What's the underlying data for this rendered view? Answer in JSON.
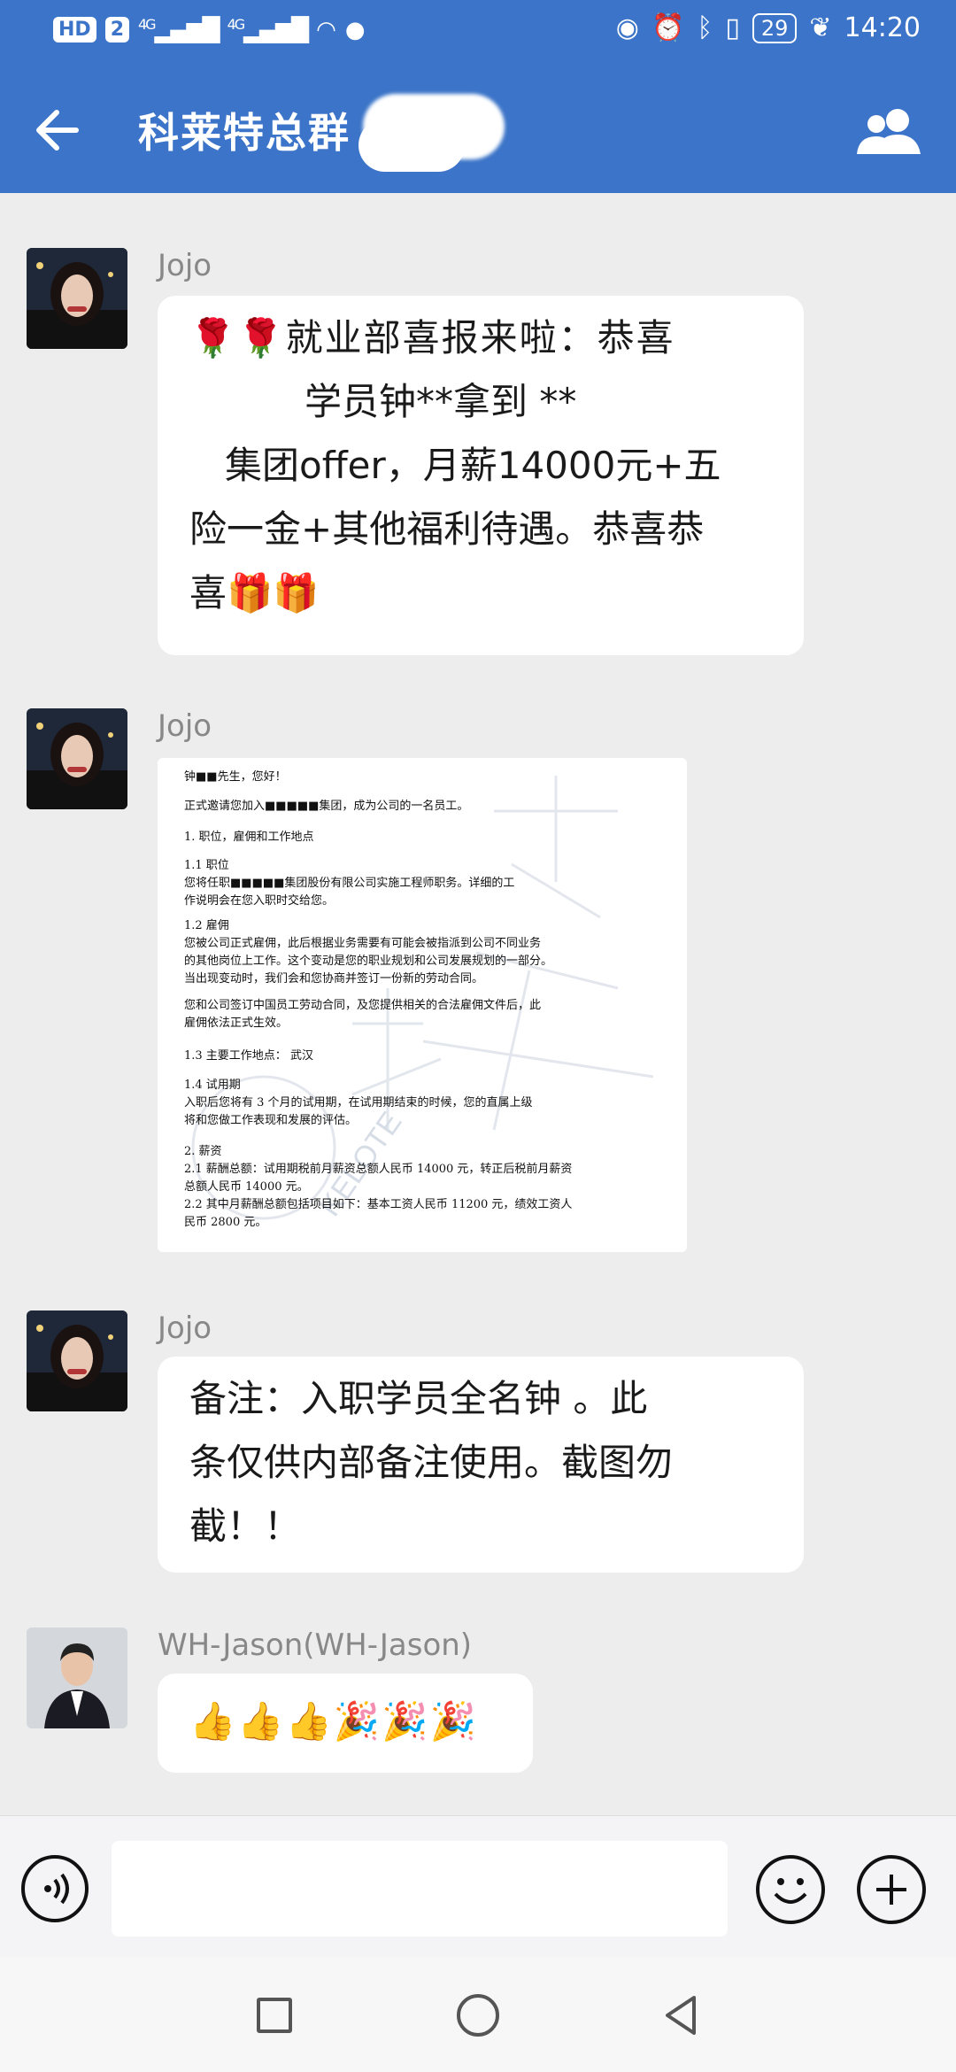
{
  "status_bar": {
    "left_badges": [
      "HD",
      "2",
      "4G",
      "4G"
    ],
    "battery": "29",
    "time": "14:20"
  },
  "header": {
    "title": "科莱特总群"
  },
  "messages": [
    {
      "sender": "Jojo",
      "lines": [
        "🌹🌹就业部喜报来啦：恭喜",
        "学员钟**拿到 **",
        "集团offer，月薪14000元+五",
        "险一金+其他福利待遇。恭喜恭",
        "喜🎁🎁"
      ]
    },
    {
      "sender": "Jojo",
      "doc": {
        "lines": [
          "钟■■先生，您好！",
          "正式邀请您加入■■■■■集团，成为公司的一名员工。",
          "1.    职位，雇佣和工作地点",
          "1.1   职位",
          "      您将任职■■■■■集团股份有限公司实施工程师职务。详细的工",
          "      作说明会在您入职时交给您。",
          "1.2   雇佣",
          "      您被公司正式雇佣，此后根据业务需要有可能会被指派到公司不同业务",
          "      的其他岗位上工作。这个变动是您的职业规划和公司发展规划的一部分。",
          "      当出现变动时，我们会和您协商并签订一份新的劳动合同。",
          "      您和公司签订中国员工劳动合同，及您提供相关的合法雇佣文件后，此",
          "      雇佣依法正式生效。",
          "1.3   主要工作地点：    武汉",
          "1.4   试用期",
          "      入职后您将有  3  个月的试用期，在试用期结束的时候，您的直属上级",
          "      将和您做工作表现和发展的评估。",
          "2.    薪资",
          "2.1   薪酬总额：试用期税前月薪资总额人民币 14000 元，转正后税前月薪资",
          "      总额人民币 14000 元。",
          "2.2   其中月薪酬总额包括项目如下：基本工资人民币 11200 元，绩效工资人",
          "      民币 2800 元。"
        ],
        "watermark": "KELOTE"
      }
    },
    {
      "sender": "Jojo",
      "lines": [
        "备注：入职学员全名钟    。此",
        "条仅供内部备注使用。截图勿",
        "截！！"
      ]
    },
    {
      "sender": "WH-Jason(WH-Jason)",
      "lines": [
        "👍👍👍🎉🎉🎉"
      ]
    }
  ],
  "input": {
    "placeholder": ""
  }
}
